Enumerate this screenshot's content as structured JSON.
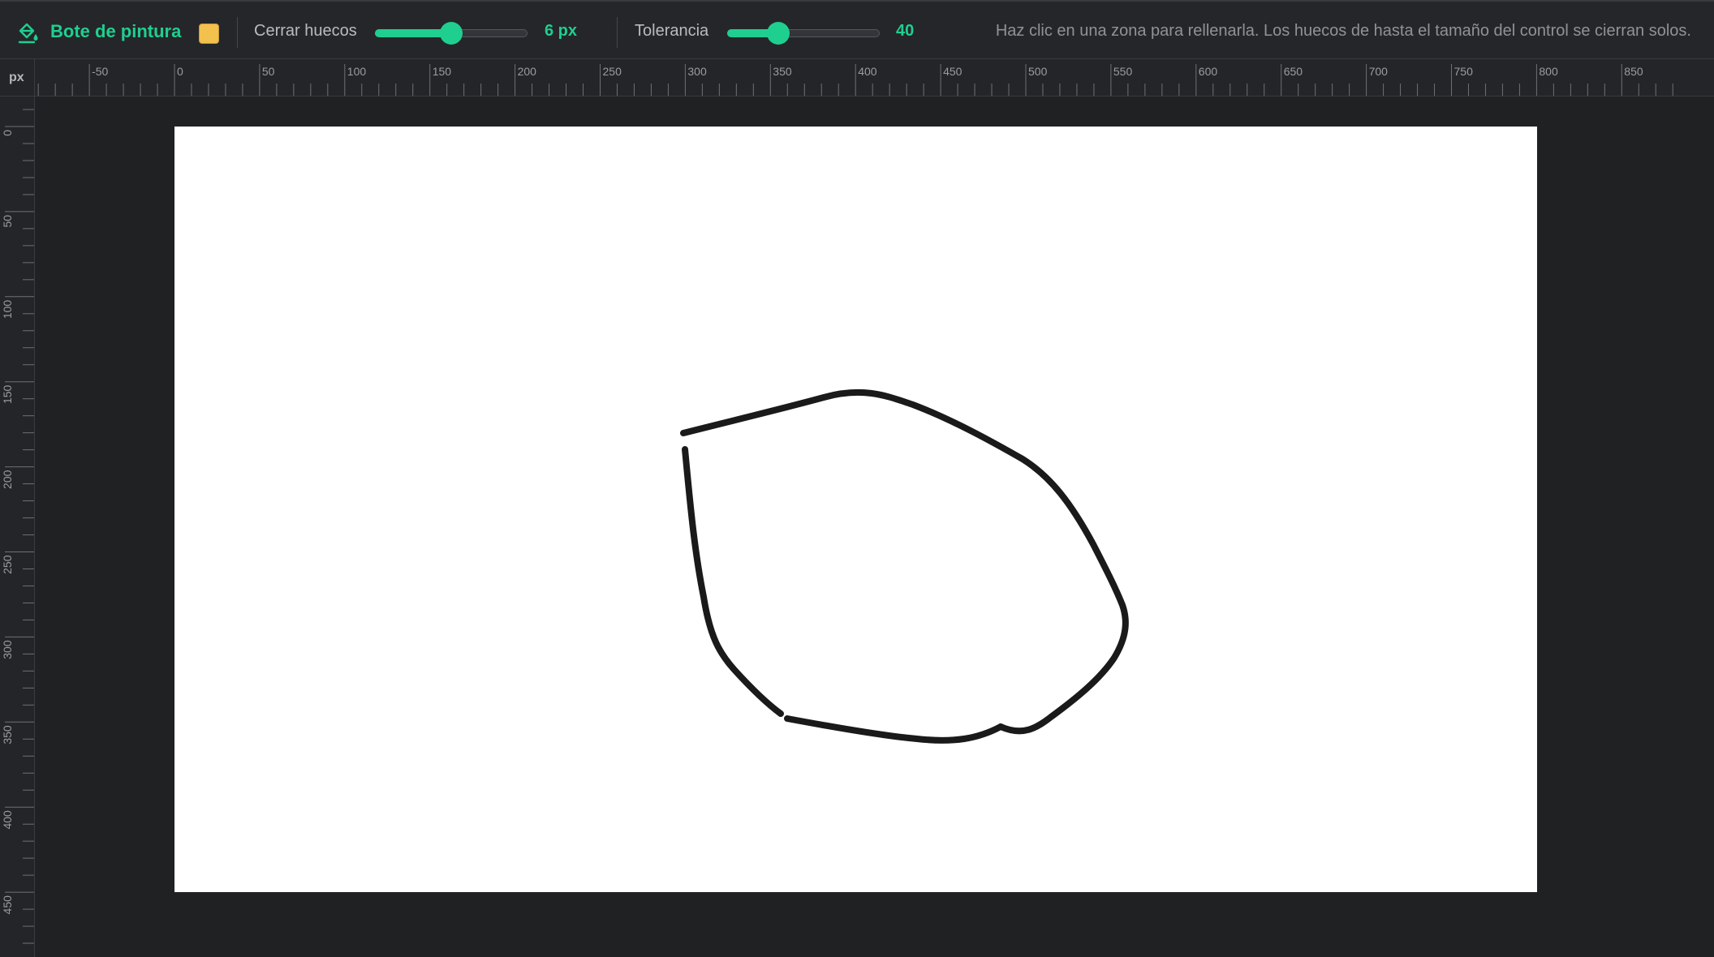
{
  "toolbar": {
    "tool_name": "Bote de pintura",
    "tool_icon": "paint-bucket-icon",
    "fill_color": "#f2c14e",
    "accent_color": "#1fcf8f",
    "gap_close": {
      "label": "Cerrar huecos",
      "value_text": "6 px",
      "value": 6,
      "min": 0,
      "max": 12
    },
    "tolerance": {
      "label": "Tolerancia",
      "value_text": "40",
      "value": 40,
      "min": 0,
      "max": 120
    },
    "hint": "Haz clic en una zona para rellenarla. Los huecos de hasta el tamaño del control se cierran solos."
  },
  "ruler": {
    "unit": "px",
    "horizontal_labels": [
      "-50",
      "0",
      "50",
      "100",
      "150",
      "200",
      "250",
      "300",
      "350",
      "400",
      "450",
      "500",
      "550",
      "600",
      "650",
      "700",
      "750",
      "800",
      "850"
    ],
    "vertical_labels": [
      "0",
      "50",
      "100",
      "150",
      "200",
      "250",
      "300",
      "350",
      "400",
      "450"
    ]
  },
  "canvas": {
    "background": "#ffffff",
    "stroke_color": "#1a1a1a"
  }
}
